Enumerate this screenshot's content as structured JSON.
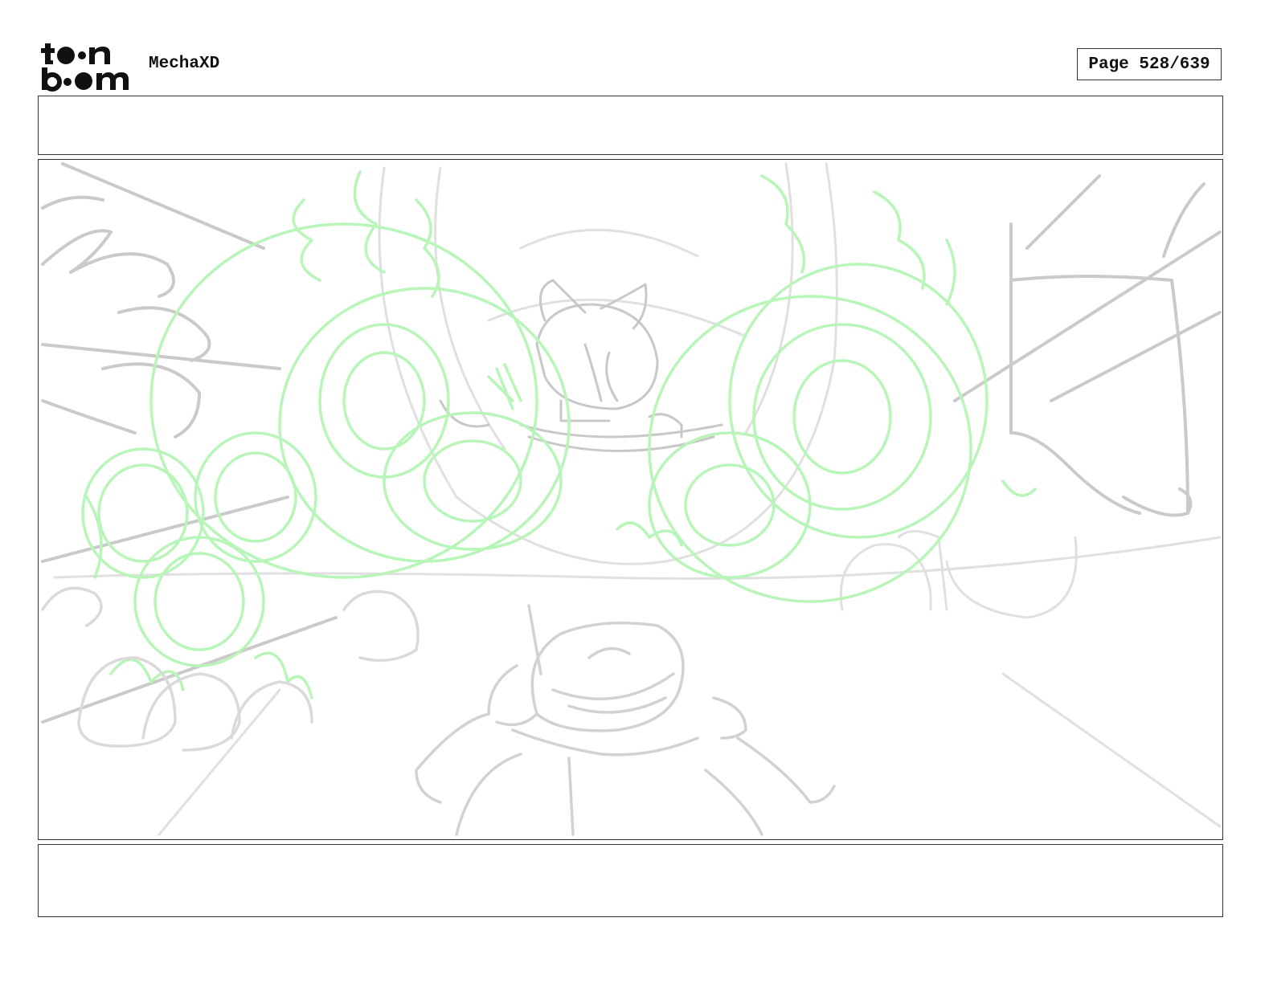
{
  "header": {
    "logo_text": "toon boom",
    "project_title": "MechaXD",
    "page_label": "Page 528/639"
  },
  "panel": {
    "icon": "storyboard-sketch",
    "sketch_colors": {
      "pencil": "#c8c8c8",
      "pencil_light": "#dedede",
      "energy": "#b8f5b8"
    }
  },
  "notes_top": {
    "text": ""
  },
  "notes_bottom": {
    "text": ""
  }
}
